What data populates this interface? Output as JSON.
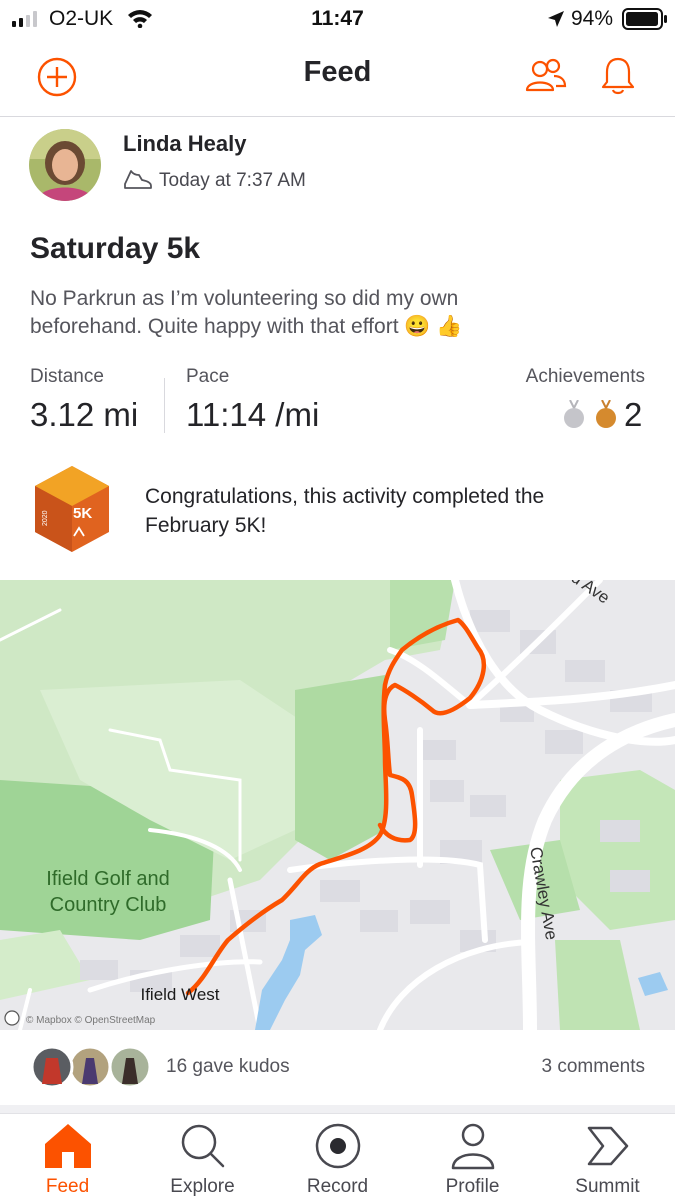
{
  "status_bar": {
    "carrier": "O2-UK",
    "time": "11:47",
    "battery": "94%"
  },
  "header": {
    "title": "Feed"
  },
  "activity": {
    "athlete_name": "Linda Healy",
    "timestamp": "Today at 7:37 AM",
    "title": "Saturday 5k",
    "description_line1": "No Parkrun as I’m volunteering so did my own",
    "description_line2": "beforehand. Quite happy with that effort 😀 👍",
    "stats": [
      {
        "label": "Distance",
        "value": "3.12 mi"
      },
      {
        "label": "Pace",
        "value": "11:14 /mi"
      },
      {
        "label": "Achievements",
        "value": "2"
      }
    ],
    "challenge": {
      "badge_label": "5K",
      "badge_year": "2020",
      "line1": "Congratulations, this activity completed the",
      "line2": "February 5K!"
    }
  },
  "map": {
    "labels": {
      "golf_line1": "Ifield Golf and",
      "golf_line2": "Country Club",
      "ifield_west": "Ifield West",
      "crawley_ave": "Crawley Ave",
      "ave_top": "d Ave",
      "attribution": "© Mapbox © OpenStreetMap"
    },
    "route_color": "#fc5200"
  },
  "social": {
    "kudos": "16 gave kudos",
    "comments": "3 comments"
  },
  "tabbar": {
    "items": [
      {
        "label": "Feed",
        "icon": "home-icon",
        "active": true
      },
      {
        "label": "Explore",
        "icon": "search-icon",
        "active": false
      },
      {
        "label": "Record",
        "icon": "record-icon",
        "active": false
      },
      {
        "label": "Profile",
        "icon": "person-icon",
        "active": false
      },
      {
        "label": "Summit",
        "icon": "summit-icon",
        "active": false
      }
    ]
  },
  "colors": {
    "accent": "#fc5200",
    "text": "#242428",
    "muted": "#55555c"
  }
}
